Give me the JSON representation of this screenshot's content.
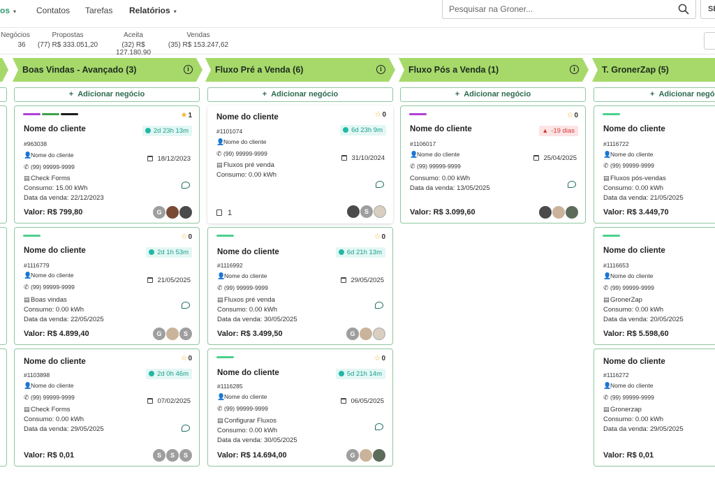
{
  "nav": {
    "items": [
      {
        "label": "os",
        "caret": "▾"
      },
      {
        "label": "Contatos"
      },
      {
        "label": "Tarefas"
      },
      {
        "label": "Relatórios",
        "caret": "▾"
      }
    ],
    "search_placeholder": "Pesquisar na Groner...",
    "right_button": "SE"
  },
  "stats": [
    {
      "label": "Negócios",
      "value": "36"
    },
    {
      "label": "Propostas",
      "value": "(77) R$ 333.051,20"
    },
    {
      "label": "Aceita",
      "value": "(32) R$ 127.180,90"
    },
    {
      "label": "Vendas",
      "value": "(35) R$ 153.247,62"
    }
  ],
  "add_label": "Adicionar negócio",
  "columns": [
    {
      "title": "Boas Vindas - Avançado (3)",
      "cards": [
        {
          "tags": [
            "#b03fd6",
            "#3ba14a",
            "#1a1a1a"
          ],
          "star": "1",
          "star_filled": true,
          "name": "Nome do cliente",
          "badge": "2d 23h 13m",
          "badge_type": "teal",
          "id": "#963038",
          "contact": "Nome do cliente",
          "date": "18/12/2023",
          "phone": "(99) 99999-9999",
          "flow": "Check Forms",
          "consumo": "Consumo: 15.00 kWh",
          "venda": "Data da venda: 22/12/2023",
          "value": "Valor: R$ 799,80",
          "avatars": [
            "G",
            "",
            ""
          ]
        },
        {
          "tags": [
            "#4cd08b"
          ],
          "star": "0",
          "name": "Nome do cliente",
          "badge": "2d 1h 53m",
          "badge_type": "teal",
          "id": "#1116779",
          "contact": "Nome do cliente",
          "date": "21/05/2025",
          "phone": "(99) 99999-9999",
          "flow": "Boas vindas",
          "consumo": "Consumo: 0.00 kWh",
          "venda": "Data da venda: 22/05/2025",
          "value": "Valor: R$ 4.899,40",
          "avatars": [
            "G",
            "",
            "S"
          ]
        },
        {
          "tags": [],
          "star": "0",
          "name": "Nome do cliente",
          "badge": "2d 0h 46m",
          "badge_type": "teal",
          "id": "#1103898",
          "contact": "Nome do cliente",
          "date": "07/02/2025",
          "phone": "(99) 99999-9999",
          "flow": "Check Forms",
          "consumo": "Consumo: 0.00 kWh",
          "venda": "Data da venda: 29/05/2025",
          "value": "Valor: R$ 0,01",
          "avatars": [
            "S",
            "S",
            "S"
          ]
        }
      ]
    },
    {
      "title": "Fluxo Pré a Venda (6)",
      "cards": [
        {
          "tags": [],
          "star": "0",
          "name": "Nome do cliente",
          "badge": "6d 23h 9m",
          "badge_type": "teal",
          "id": "#1101074",
          "contact": "Nome do cliente",
          "date": "31/10/2024",
          "phone": "(99) 99999-9999",
          "flow": "Fluxos pré venda",
          "consumo": "Consumo: 0.00 kWh",
          "venda": "",
          "doc_count": "1",
          "value": "",
          "avatars": [
            "",
            "S",
            ""
          ]
        },
        {
          "tags": [
            "#4cd08b"
          ],
          "star": "0",
          "name": "Nome do cliente",
          "badge": "6d 21h 13m",
          "badge_type": "teal",
          "id": "#1116992",
          "contact": "Nome do cliente",
          "date": "29/05/2025",
          "phone": "(99) 99999-9999",
          "flow": "Fluxos pré venda",
          "consumo": "Consumo: 0.00 kWh",
          "venda": "Data da venda: 30/05/2025",
          "value": "Valor: R$ 3.499,50",
          "avatars": [
            "G",
            "",
            ""
          ]
        },
        {
          "tags": [
            "#4cd08b"
          ],
          "star": "0",
          "name": "Nome do cliente",
          "badge": "5d 21h 14m",
          "badge_type": "teal",
          "id": "#1116285",
          "contact": "Nome do cliente",
          "date": "06/05/2025",
          "phone": "(99) 99999-9999",
          "flow": "Configurar Fluxos",
          "consumo": "Consumo: 0.00 kWh",
          "venda": "Data da venda: 30/05/2025",
          "value": "Valor: R$ 14.694,00",
          "avatars": [
            "G",
            "",
            ""
          ]
        }
      ]
    },
    {
      "title": "Fluxo Pós a Venda (1)",
      "cards": [
        {
          "tags": [
            "#b03fd6"
          ],
          "star": "0",
          "name": "Nome do cliente",
          "badge": "-19 dias",
          "badge_type": "red",
          "id": "#1106017",
          "contact": "Nome do cliente",
          "date": "25/04/2025",
          "phone": "(99) 99999-9999",
          "flow": "",
          "consumo": "Consumo: 0.00 kWh",
          "venda": "Data da venda: 13/05/2025",
          "value": "Valor: R$ 3.099,60",
          "avatars": [
            "",
            "",
            ""
          ]
        }
      ]
    },
    {
      "title": "T. GronerZap (5)",
      "cards": [
        {
          "tags": [
            "#4cd08b"
          ],
          "name": "Nome do cliente",
          "id": "#1116722",
          "contact": "Nome do cliente",
          "phone": "(99) 99999-9999",
          "flow": "Fluxos pós-vendas",
          "consumo": "Consumo: 0.00 kWh",
          "venda": "Data da venda: 21/05/2025",
          "value": "Valor: R$ 3.449,70"
        },
        {
          "tags": [
            "#4cd08b"
          ],
          "name": "Nome do cliente",
          "id": "#1116653",
          "contact": "Nome do cliente",
          "phone": "(99) 99999-9999",
          "flow": "GronerZap",
          "consumo": "Consumo: 0.00 kWh",
          "venda": "Data da venda: 20/05/2025",
          "value": "Valor: R$ 5.598,60"
        },
        {
          "tags": [],
          "name": "Nome do cliente",
          "id": "#1116272",
          "contact": "Nome do cliente",
          "phone": "(99) 99999-9999",
          "flow": "Gronerzap",
          "consumo": "Consumo: 0.00 kWh",
          "venda": "Data da venda: 29/05/2025",
          "value": "Valor: R$ 0,01"
        }
      ]
    }
  ]
}
